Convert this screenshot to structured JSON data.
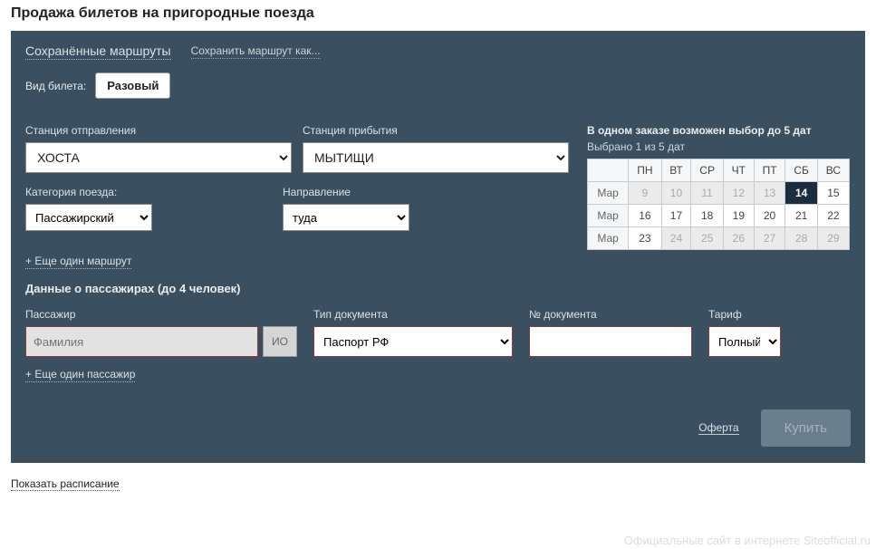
{
  "page_title": "Продажа билетов на пригородные поезда",
  "top": {
    "saved_routes": "Сохранённые маршруты",
    "save_as": "Сохранить маршрут как..."
  },
  "ticket_type": {
    "label": "Вид билета:",
    "value": "Разовый"
  },
  "stations": {
    "from_label": "Станция отправления",
    "from_value": "ХОСТА",
    "to_label": "Станция прибытия",
    "to_value": "МЫТИЩИ"
  },
  "category": {
    "label": "Категория поезда:",
    "value": "Пассажирский"
  },
  "direction": {
    "label": "Направление",
    "value": "туда"
  },
  "add_route": "+ Еще один маршрут",
  "calendar": {
    "info": "В одном заказе возможен выбор до 5 дат",
    "selected_text": "Выбрано 1 из 5 дат",
    "month_label": "Мар",
    "weekdays": [
      "ПН",
      "ВТ",
      "СР",
      "ЧТ",
      "ПТ",
      "СБ",
      "ВС"
    ],
    "rows": [
      {
        "days": [
          {
            "n": 9,
            "d": true
          },
          {
            "n": 10,
            "d": true
          },
          {
            "n": 11,
            "d": true
          },
          {
            "n": 12,
            "d": true
          },
          {
            "n": 13,
            "d": true
          },
          {
            "n": 14,
            "sel": true
          },
          {
            "n": 15
          }
        ]
      },
      {
        "days": [
          {
            "n": 16
          },
          {
            "n": 17
          },
          {
            "n": 18
          },
          {
            "n": 19
          },
          {
            "n": 20
          },
          {
            "n": 21
          },
          {
            "n": 22
          }
        ]
      },
      {
        "days": [
          {
            "n": 23
          },
          {
            "n": 24,
            "d": true
          },
          {
            "n": 25,
            "d": true
          },
          {
            "n": 26,
            "d": true
          },
          {
            "n": 27,
            "d": true
          },
          {
            "n": 28,
            "d": true
          },
          {
            "n": 29,
            "d": true
          }
        ]
      }
    ]
  },
  "passengers": {
    "title": "Данные о пассажирах (до 4 человек)",
    "label": "Пассажир",
    "surname_placeholder": "Фамилия",
    "io": "ИО",
    "doc_type_label": "Тип документа",
    "doc_type_value": "Паспорт РФ",
    "doc_num_label": "№ документа",
    "tariff_label": "Тариф",
    "tariff_value": "Полный",
    "add_passenger": "+ Еще один пассажир"
  },
  "footer": {
    "oferta": "Оферта",
    "buy": "Купить"
  },
  "show_schedule": "Показать расписание",
  "watermark": "Официальные сайт в интернете Siteofficial.ru"
}
